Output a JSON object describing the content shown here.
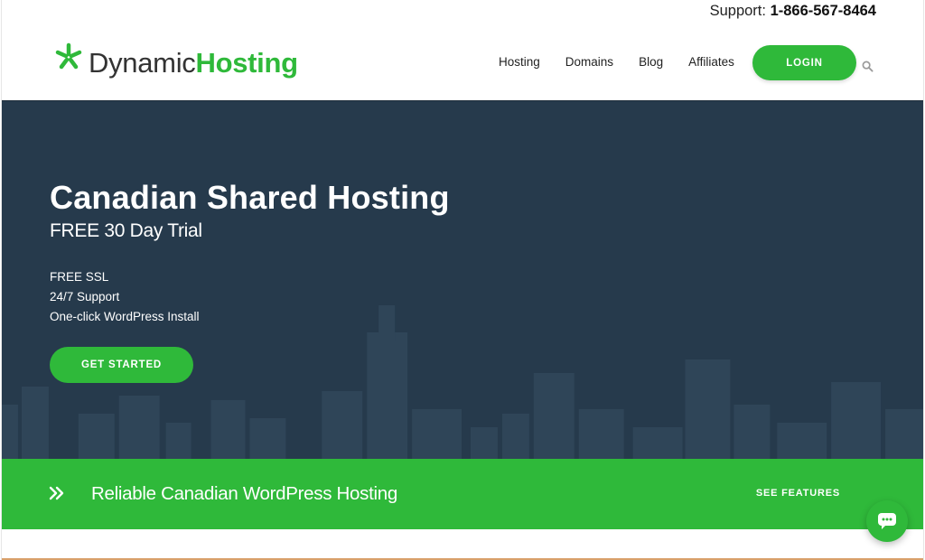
{
  "header": {
    "support_label": "Support:",
    "support_phone": "1-866-567-8464",
    "logo": {
      "part1": "Dynamic",
      "part2": "Hosting",
      "star_icon": "asterisk-icon"
    },
    "nav": [
      {
        "label": "Hosting"
      },
      {
        "label": "Domains"
      },
      {
        "label": "Blog"
      },
      {
        "label": "Affiliates"
      }
    ],
    "login_label": "LOGIN",
    "search_icon": "search-icon"
  },
  "hero": {
    "title": "Canadian Shared Hosting",
    "subtitle": "FREE 30 Day Trial",
    "features": [
      "FREE SSL",
      "24/7 Support",
      "One-click WordPress Install"
    ],
    "cta_label": "GET STARTED"
  },
  "band": {
    "icon": "double-chevron-right-icon",
    "text": "Reliable Canadian WordPress Hosting",
    "link_label": "SEE FEATURES"
  },
  "chat": {
    "icon": "chat-bubble-icon"
  },
  "colors": {
    "brand_green": "#2fb93a",
    "hero_bg": "#263a4c",
    "skyline": "#2f4558"
  }
}
